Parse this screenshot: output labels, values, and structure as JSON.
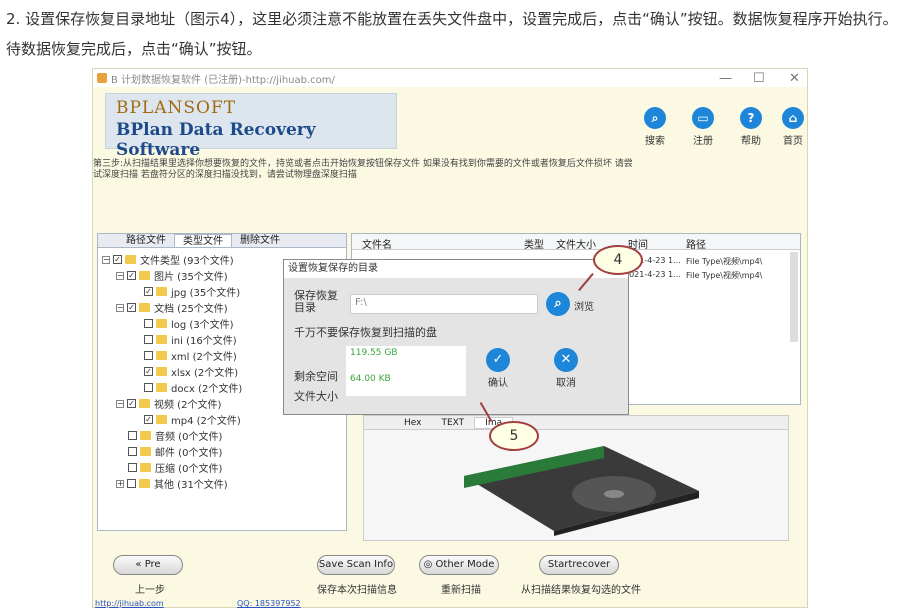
{
  "article": {
    "instruction": "2. 设置保存恢复目录地址（图示4），这里必须注意不能放置在丢失文件盘中，设置完成后，点击“确认”按钮。数据恢复程序开始执行。待数据恢复完成后，点击“确认”按钮。"
  },
  "window": {
    "title": "B 计划数据恢复软件 (已注册)-http://jihuab.com/",
    "controls": {
      "minimize": "—",
      "maximize": "☐",
      "close": "✕"
    },
    "brand": "BPLANSOFT",
    "product": "BPlan Data Recovery Software"
  },
  "toolbar": {
    "search": "搜索",
    "register": "注册",
    "help": "帮助",
    "home": "首页"
  },
  "step_text": "第三步:从扫描结果里选择你想要恢复的文件，持览或者点击开始恢复按钮保存文件 如果没有找到你需要的文件或者恢复后文件损坏 请尝试深度扫描 若盘符分区的深度扫描没找到，请尝试物理盘深度扫描",
  "tree": {
    "tabs": [
      "路径文件",
      "类型文件",
      "删除文件"
    ],
    "nodes": [
      {
        "label": "文件类型 (93个文件)"
      },
      {
        "label": "图片 (35个文件)"
      },
      {
        "label": "jpg (35个文件)"
      },
      {
        "label": "文档 (25个文件)"
      },
      {
        "label": "log (3个文件)"
      },
      {
        "label": "ini (16个文件)"
      },
      {
        "label": "xml (2个文件)"
      },
      {
        "label": "xlsx (2个文件)"
      },
      {
        "label": "docx (2个文件)"
      },
      {
        "label": "视频 (2个文件)"
      },
      {
        "label": "mp4 (2个文件)"
      },
      {
        "label": "音频 (0个文件)"
      },
      {
        "label": "邮件 (0个文件)"
      },
      {
        "label": "压缩 (0个文件)"
      },
      {
        "label": "其他 (31个文件)"
      }
    ]
  },
  "list": {
    "headers": [
      "文件名",
      "类型",
      "文件大小",
      "时间",
      "路径"
    ],
    "rows": [
      {
        "time": "2021-4-23 1...",
        "path": "File Type\\视频\\mp4\\"
      },
      {
        "time": "2021-4-23 1...",
        "path": "File Type\\视频\\mp4\\"
      }
    ]
  },
  "preview": {
    "tabs": [
      "Hex",
      "TEXT",
      "Ima"
    ]
  },
  "dialog": {
    "title": "设置恢复保存的目录",
    "dir_label": "保存恢复目录",
    "dir_value": "F:\\",
    "browse_label": "浏览",
    "warning": "千万不要保存恢复到扫描的盘",
    "free_label": "剩余空间",
    "size_label": "文件大小",
    "free_value": "119.55 GB",
    "size_value": "64.00 KB",
    "confirm_label": "确认",
    "cancel_label": "取消"
  },
  "callouts": {
    "four": "4",
    "five": "5"
  },
  "bottom": {
    "pre_label": "Pre",
    "pre_caption": "上一步",
    "save_label": "Save Scan Info",
    "save_caption": "保存本次扫描信息",
    "other_label": "Other Mode",
    "other_caption": "重新扫描",
    "start_label": "Startrecover",
    "start_caption": "从扫描结果恢复勾选的文件",
    "link": "http://jihuab.com",
    "qq": "QQ: 185397952"
  }
}
